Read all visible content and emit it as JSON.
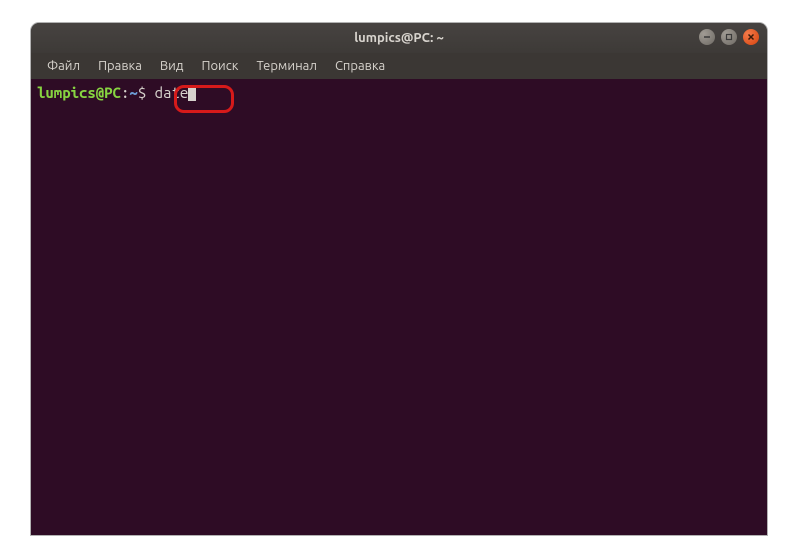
{
  "window": {
    "title": "lumpics@PC: ~"
  },
  "menubar": {
    "items": [
      {
        "label": "Файл"
      },
      {
        "label": "Правка"
      },
      {
        "label": "Вид"
      },
      {
        "label": "Поиск"
      },
      {
        "label": "Терминал"
      },
      {
        "label": "Справка"
      }
    ]
  },
  "terminal": {
    "prompt_userhost": "lumpics@PC",
    "prompt_colon": ":",
    "prompt_path": "~",
    "prompt_dollar": "$ ",
    "command": "date"
  }
}
